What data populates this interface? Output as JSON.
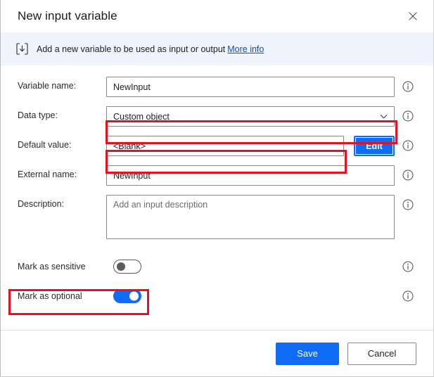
{
  "dialog": {
    "title": "New input variable",
    "close_label": "Close"
  },
  "banner": {
    "icon": "input-variable-icon",
    "text": "Add a new variable to be used as input or output",
    "link_label": "More info",
    "background": "#eff4fd"
  },
  "form": {
    "variable_name": {
      "label": "Variable name:",
      "value": "NewInput",
      "placeholder": "",
      "info_tooltip": "info-icon"
    },
    "data_type": {
      "label": "Data type:",
      "value": "Custom object",
      "options": [
        "Custom object"
      ],
      "highlighted": true
    },
    "default_value": {
      "label": "Default value:",
      "value": "<Blank>",
      "placeholder": "",
      "edit_label": "Edit",
      "highlighted": true
    },
    "external_name": {
      "label": "External name:",
      "value": "NewInput",
      "placeholder": ""
    },
    "description": {
      "label": "Description:",
      "value": "",
      "placeholder": "Add an input description"
    },
    "mark_as_sensitive": {
      "label": "Mark as sensitive",
      "state": "off"
    },
    "mark_as_optional": {
      "label": "Mark as optional",
      "state": "on",
      "highlighted": true
    }
  },
  "footer": {
    "save_label": "Save",
    "cancel_label": "Cancel"
  },
  "colors": {
    "accent": "#0f6cf5",
    "highlight": "#e81123",
    "link": "#0f4fb5",
    "banner_bg": "#eff4fd"
  }
}
